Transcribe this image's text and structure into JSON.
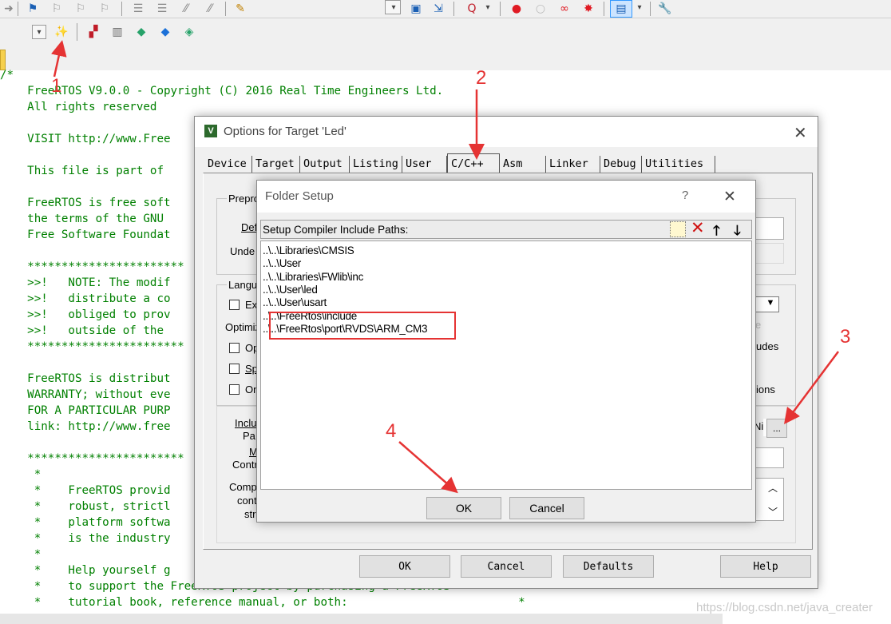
{
  "toolbar1": {
    "icons": [
      "arrow-right-icon",
      "bookmark-icon",
      "bookmark-prev-icon",
      "bookmark-next-icon",
      "bookmark-clear-icon",
      "indent-icon",
      "unindent-icon",
      "comment-icon",
      "uncomment-icon",
      "find-in-files-icon",
      "dropdown-icon",
      "debug-icon",
      "insert-breakpoint-icon",
      "debug-dropdown-icon",
      "breakpoint-icon",
      "disable-breakpoint-icon",
      "kill-breakpoints-icon",
      "clear-breakpoints-icon",
      "window-icon",
      "wrench-icon"
    ]
  },
  "toolbar2": {
    "icons": [
      "target-dropdown-icon",
      "magic-wand-options-icon",
      "manage-components-icon",
      "file-extensions-icon",
      "diamond-green-icon",
      "diamond-blue-icon",
      "pack-installer-icon"
    ]
  },
  "code_lines": [
    "/*",
    "    FreeRTOS V9.0.0 - Copyright (C) 2016 Real Time Engineers Ltd.",
    "    All rights reserved",
    "",
    "    VISIT http://www.Free",
    "",
    "    This file is part of",
    "",
    "    FreeRTOS is free soft",
    "    the terms of the GNU",
    "    Free Software Foundat",
    "",
    "    ***********************",
    "    >>!   NOTE: The modif",
    "    >>!   distribute a co",
    "    >>!   obliged to prov",
    "    >>!   outside of the",
    "    ***********************",
    "",
    "    FreeRTOS is distribut",
    "    WARRANTY; without eve",
    "    FOR A PARTICULAR PURP",
    "    link: http://www.free",
    "",
    "    ***********************",
    "     *",
    "     *    FreeRTOS provid",
    "     *    robust, strictl",
    "     *    platform softwa",
    "     *    is the industry",
    "     *",
    "     *    Help yourself g",
    "     *    to support the FreeRTOS project by purchasing a FreeRTOS           *",
    "     *    tutorial book, reference manual, or both:                         *"
  ],
  "options_dialog": {
    "title": "Options for Target 'Led'",
    "tabs": [
      "Device",
      "Target",
      "Output",
      "Listing",
      "User",
      "C/C++",
      "Asm",
      "Linker",
      "Debug",
      "Utilities"
    ],
    "active_tab": "C/C++",
    "labels": {
      "preproc": "Prepro",
      "define": "Def",
      "undefine": "Unde",
      "language": "Langu",
      "ex": "Ex",
      "optimize": "Optimiz",
      "op": "Op",
      "sp": "Sp",
      "on": "On",
      "include": "Inclu",
      "paths": "Pa",
      "misc": "M",
      "controls": "Contr",
      "compiler": "Comp",
      "control": "cont",
      "string": "str",
      "right_e": "e",
      "right_udes": "udes",
      "right_ions": "ions",
      "ni": "Ni",
      "browse": "..."
    },
    "buttons": {
      "ok": "OK",
      "cancel": "Cancel",
      "defaults": "Defaults",
      "help": "Help"
    }
  },
  "folder_dialog": {
    "title": "Folder Setup",
    "help": "?",
    "header": "Setup Compiler Include Paths:",
    "toolbar_icons": [
      "new-folder-icon",
      "delete-icon",
      "move-up-icon",
      "move-down-icon"
    ],
    "paths": [
      "..\\..\\Libraries\\CMSIS",
      "..\\..\\User",
      "..\\..\\Libraries\\FWlib\\inc",
      "..\\..\\User\\led",
      "..\\..\\User\\usart",
      "..\\..\\FreeRtos\\include",
      "..\\..\\FreeRtos\\port\\RVDS\\ARM_CM3"
    ],
    "buttons": {
      "ok": "OK",
      "cancel": "Cancel"
    }
  },
  "annotations": {
    "a1": "1",
    "a2": "2",
    "a3": "3",
    "a4": "4",
    "color": "#e53333"
  },
  "watermark": "https://blog.csdn.net/java_creater"
}
